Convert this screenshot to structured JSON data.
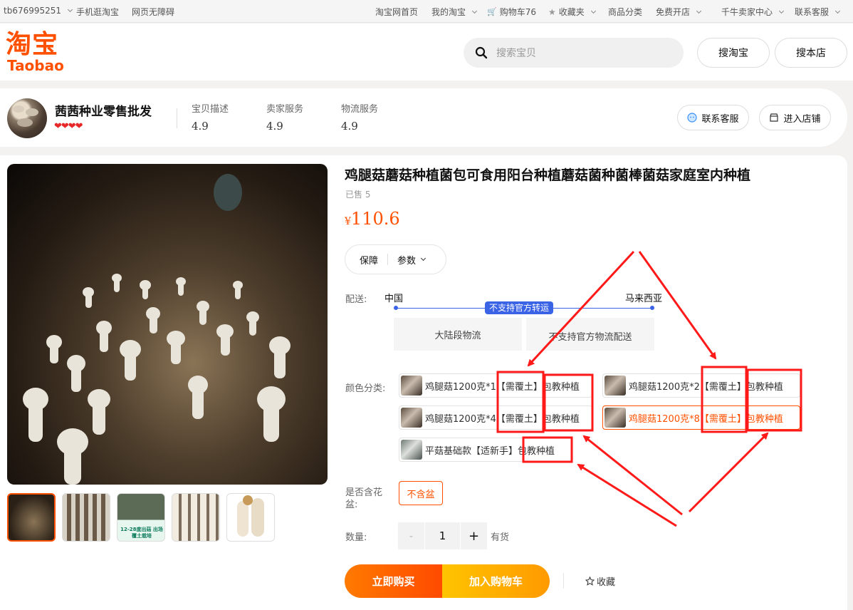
{
  "topbar": {
    "username": "tb676995251",
    "mobile": "手机逛淘宝",
    "accessible": "网页无障碍",
    "home": "淘宝网首页",
    "my_taobao": "我的淘宝",
    "cart": "购物车76",
    "favorites": "收藏夹",
    "categories": "商品分类",
    "open_store": "免费开店",
    "seller_center": "千牛卖家中心",
    "contact": "联系客服"
  },
  "header": {
    "logo_cn": "淘宝",
    "logo_en": "Taobao",
    "search_placeholder": "搜索宝贝",
    "search_taobao": "搜淘宝",
    "search_store": "搜本店"
  },
  "shop": {
    "name": "茜茜种业零售批发",
    "hearts": "❤❤❤❤",
    "scores": [
      {
        "label": "宝贝描述",
        "value": "4.9"
      },
      {
        "label": "卖家服务",
        "value": "4.9"
      },
      {
        "label": "物流服务",
        "value": "4.9"
      }
    ],
    "contact_btn": "联系客服",
    "enter_btn": "进入店铺"
  },
  "product": {
    "title": "鸡腿菇蘑菇种植菌包可食用阳台种植蘑菇菌种菌棒菌菇家庭室内种植",
    "sold": "已售 5",
    "currency": "¥",
    "price": "110.6",
    "tab_guarantee": "保障",
    "tab_params": "参数",
    "ship_label": "配送:",
    "ship_from": "中国",
    "ship_to": "马来西亚",
    "ship_badge": "不支持官方转运",
    "ship_opt1": "大陆段物流",
    "ship_opt2": "不支持官方物流配送",
    "color_label": "颜色分类:",
    "options": [
      {
        "text": "鸡腿菇1200克*1【需覆土】包教种植",
        "selected": false
      },
      {
        "text": "鸡腿菇1200克*2【需覆土】包教种植",
        "selected": false
      },
      {
        "text": "鸡腿菇1200克*4【需覆土】包教种植",
        "selected": false
      },
      {
        "text": "鸡腿菇1200克*8【需覆土】包教种植",
        "selected": true
      },
      {
        "text": "平菇基础款【适新手】包教种植",
        "selected": false
      }
    ],
    "pot_label": "是否含花盆:",
    "pot_option": "不含盆",
    "qty_label": "数量:",
    "qty_minus": "-",
    "qty_value": "1",
    "qty_plus": "+",
    "stock": "有货",
    "buy_now": "立即购买",
    "add_cart": "加入购物车",
    "favorite": "收藏",
    "thumb2_caption": "12-28度出菇 出场覆土栽培"
  },
  "colors": {
    "brand": "#ff5000",
    "annotation": "#ff1a1a",
    "ship_blue": "#3b63e6"
  }
}
